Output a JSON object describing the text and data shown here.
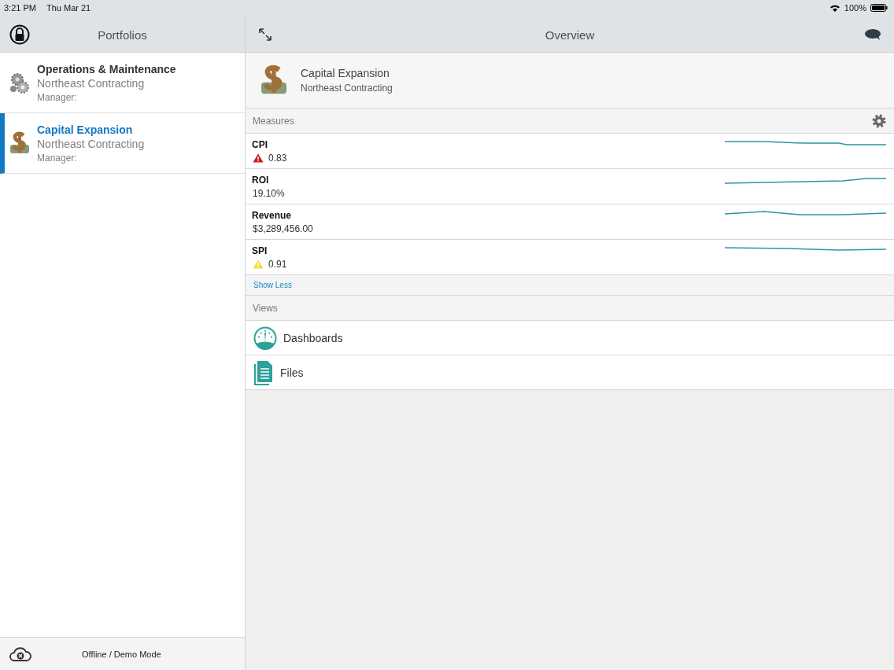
{
  "status_bar": {
    "time": "3:21 PM",
    "date": "Thu Mar 21",
    "battery": "100%"
  },
  "sidebar": {
    "title": "Portfolios",
    "items": [
      {
        "kind": "gears",
        "title": "Operations & Maintenance",
        "subtitle": "Northeast Contracting",
        "manager": "Manager:",
        "selected": false
      },
      {
        "kind": "money",
        "title": "Capital Expansion",
        "subtitle": "Northeast Contracting",
        "manager": "Manager:",
        "selected": true
      }
    ],
    "footer": "Offline / Demo Mode"
  },
  "main": {
    "title": "Overview",
    "portfolio": {
      "title": "Capital Expansion",
      "subtitle": "Northeast Contracting"
    },
    "measures_title": "Measures",
    "measures": [
      {
        "kind": "critical",
        "name": "CPI",
        "value": "0.83"
      },
      {
        "kind": "plain",
        "name": "ROI",
        "value": "19.10%"
      },
      {
        "kind": "plain",
        "name": "Revenue",
        "value": "$3,289,456.00"
      },
      {
        "kind": "warning",
        "name": "SPI",
        "value": "0.91"
      }
    ],
    "show_less": "Show Less",
    "views_title": "Views",
    "views": [
      {
        "kind": "dashboard",
        "label": "Dashboards"
      },
      {
        "kind": "files",
        "label": "Files"
      }
    ]
  }
}
